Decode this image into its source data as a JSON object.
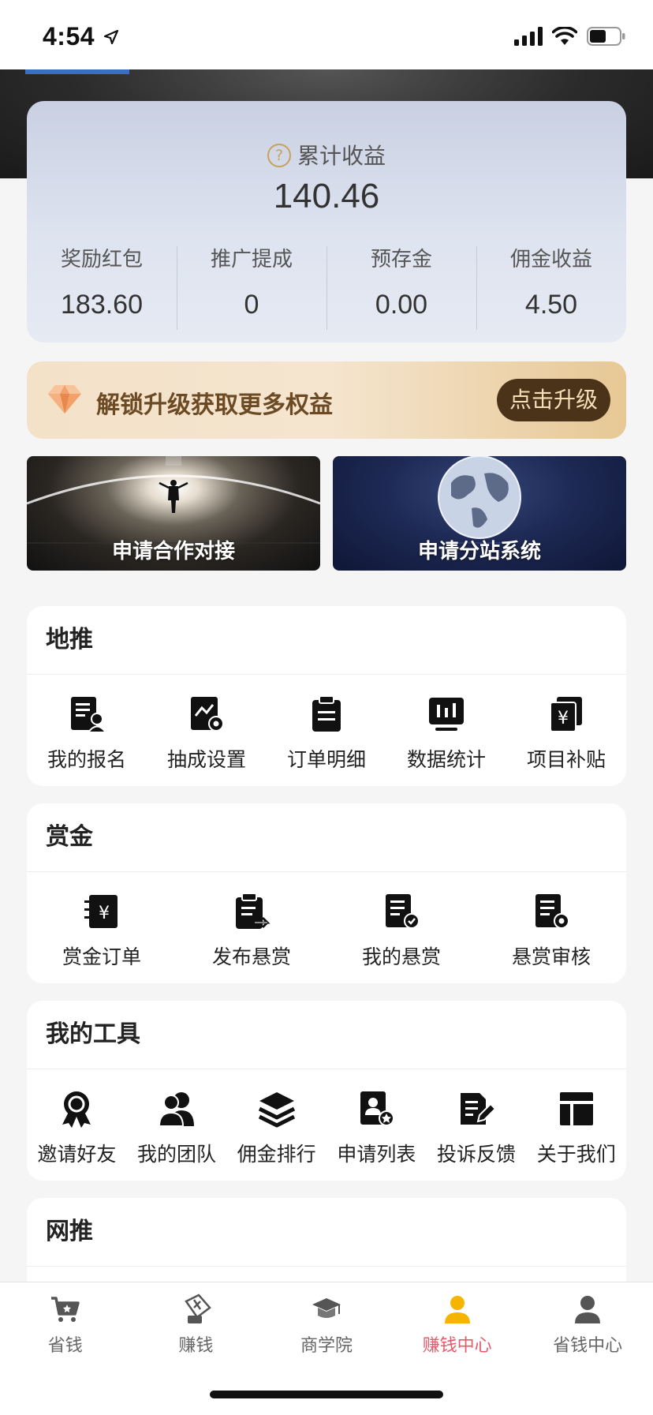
{
  "status_bar": {
    "time": "4:54"
  },
  "earnings": {
    "title": "累计收益",
    "total": "140.46",
    "stats": [
      {
        "label": "奖励红包",
        "value": "183.60"
      },
      {
        "label": "推广提成",
        "value": "0"
      },
      {
        "label": "预存金",
        "value": "0.00"
      },
      {
        "label": "佣金收益",
        "value": "4.50"
      }
    ]
  },
  "upgrade": {
    "text": "解锁升级获取更多权益",
    "button": "点击升级"
  },
  "promos": [
    {
      "label": "申请合作对接"
    },
    {
      "label": "申请分站系统"
    }
  ],
  "sections": {
    "ditui": {
      "title": "地推",
      "items": [
        {
          "label": "我的报名",
          "icon": "signup-icon"
        },
        {
          "label": "抽成设置",
          "icon": "commission-settings-icon"
        },
        {
          "label": "订单明细",
          "icon": "clipboard-icon"
        },
        {
          "label": "数据统计",
          "icon": "stats-icon"
        },
        {
          "label": "项目补贴",
          "icon": "subsidy-icon"
        }
      ]
    },
    "bounty": {
      "title": "赏金",
      "items": [
        {
          "label": "赏金订单",
          "icon": "bounty-order-icon"
        },
        {
          "label": "发布悬赏",
          "icon": "publish-bounty-icon"
        },
        {
          "label": "我的悬赏",
          "icon": "my-bounty-icon"
        },
        {
          "label": "悬赏审核",
          "icon": "bounty-review-icon"
        }
      ]
    },
    "tools": {
      "title": "我的工具",
      "items": [
        {
          "label": "邀请好友",
          "icon": "award-icon"
        },
        {
          "label": "我的团队",
          "icon": "team-icon"
        },
        {
          "label": "佣金排行",
          "icon": "layers-icon"
        },
        {
          "label": "申请列表",
          "icon": "application-list-icon"
        },
        {
          "label": "投诉反馈",
          "icon": "feedback-icon"
        },
        {
          "label": "关于我们",
          "icon": "layout-icon"
        }
      ]
    },
    "wangtui": {
      "title": "网推"
    }
  },
  "tabbar": {
    "active_color": "#e85a6a",
    "items": [
      {
        "label": "省钱",
        "icon": "cart-icon"
      },
      {
        "label": "赚钱",
        "icon": "money-tag-icon"
      },
      {
        "label": "商学院",
        "icon": "graduation-cap-icon"
      },
      {
        "label": "赚钱中心",
        "icon": "user-icon",
        "active": true
      },
      {
        "label": "省钱中心",
        "icon": "user-icon"
      }
    ]
  }
}
